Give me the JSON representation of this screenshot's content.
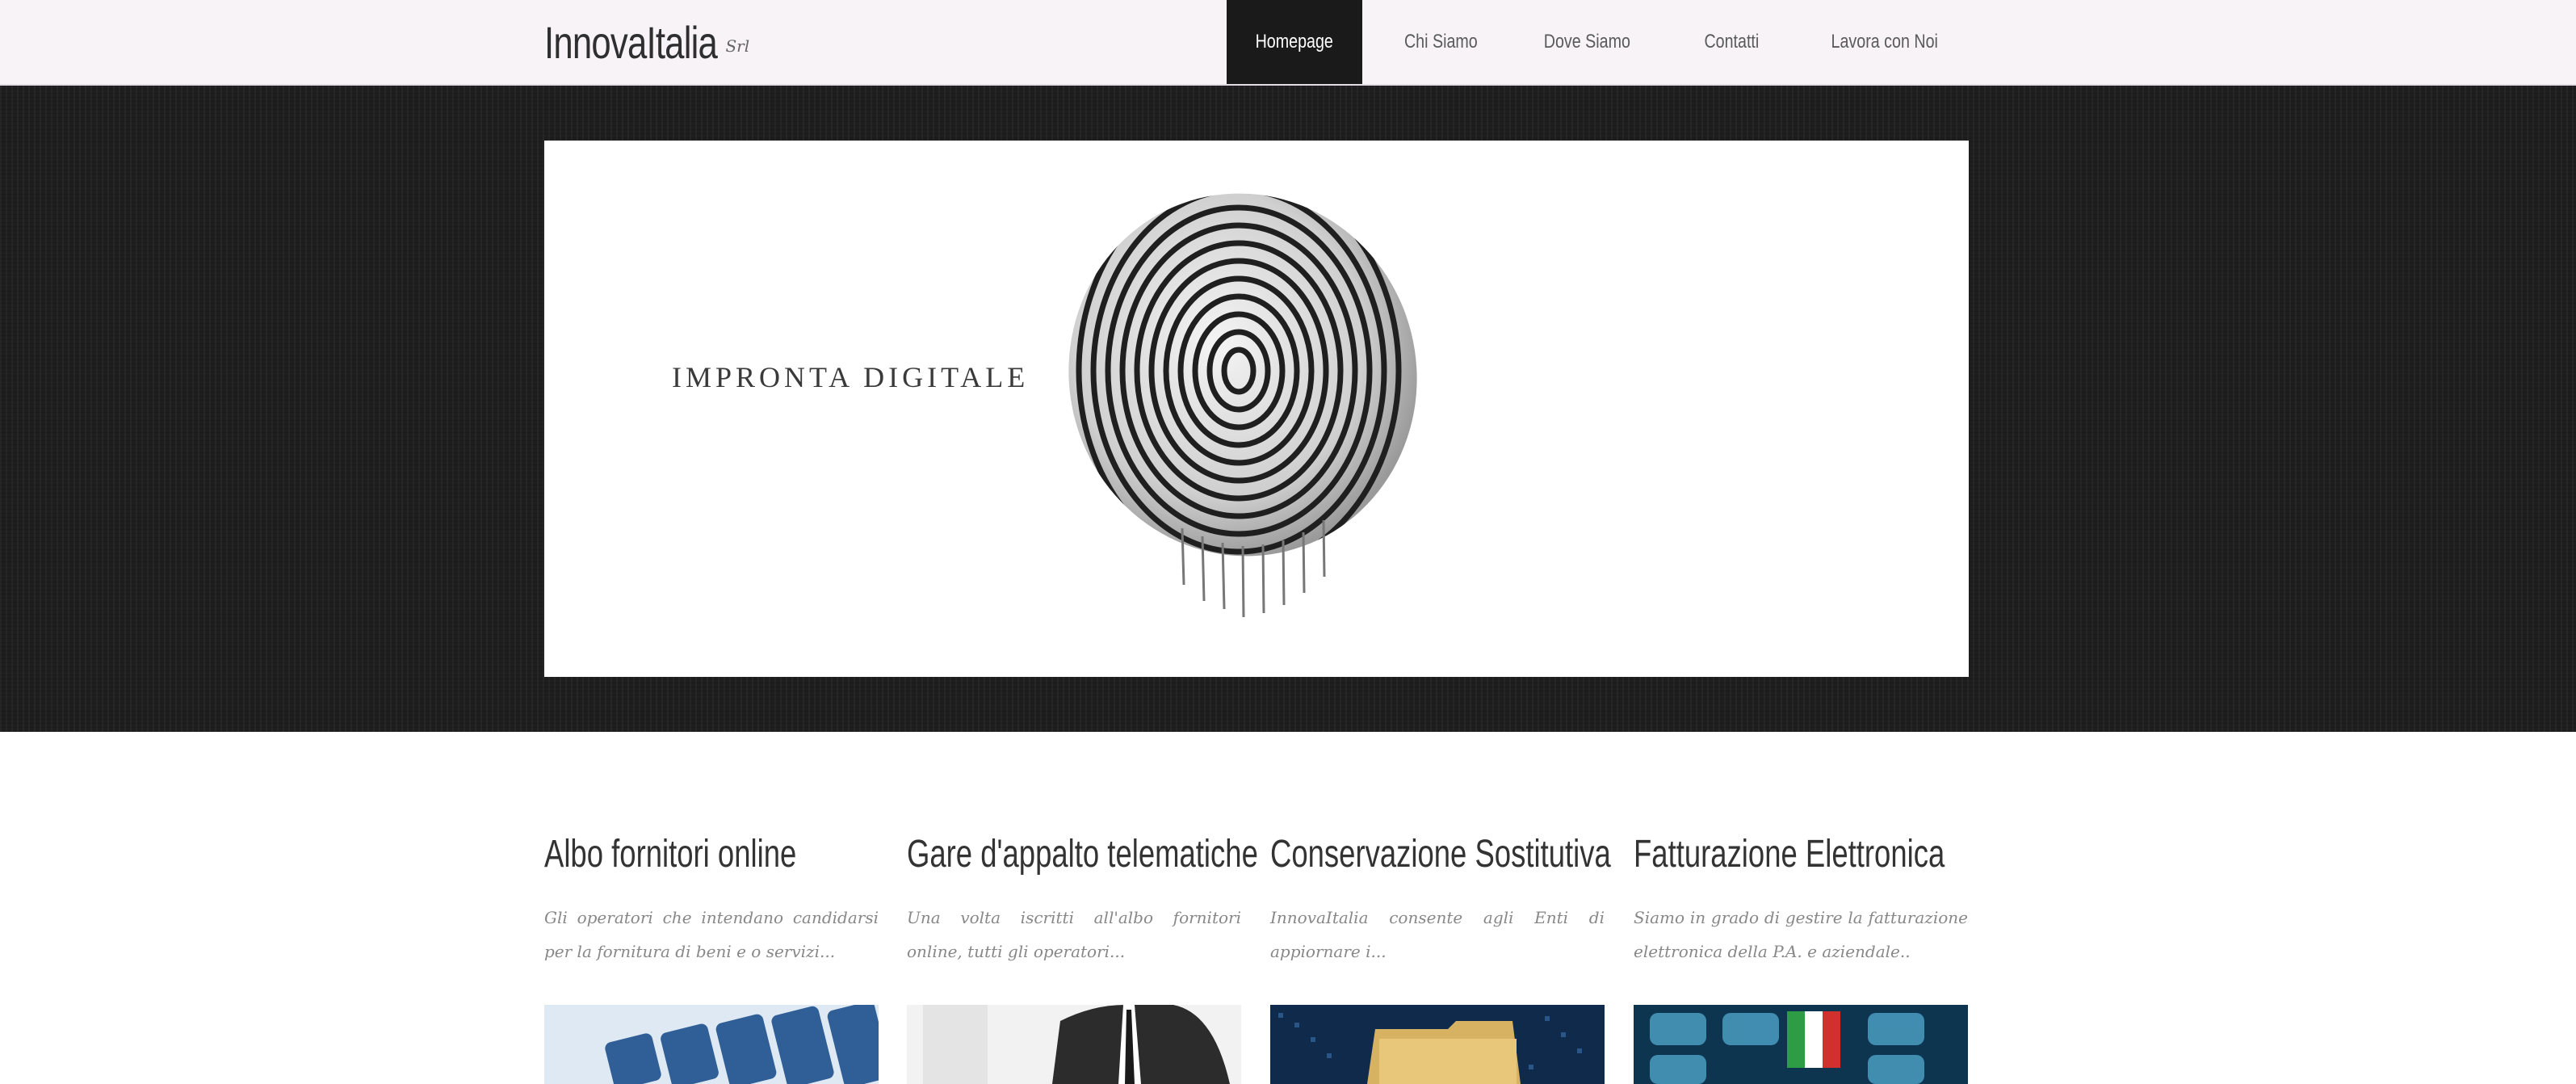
{
  "header": {
    "logo": "InnovaItalia",
    "logo_suffix": "Srl",
    "nav": [
      {
        "label": "Homepage",
        "active": true
      },
      {
        "label": "Chi Siamo",
        "active": false
      },
      {
        "label": "Dove Siamo",
        "active": false
      },
      {
        "label": "Contatti",
        "active": false
      },
      {
        "label": "Lavora con Noi",
        "active": false
      }
    ]
  },
  "hero": {
    "banner_title": "IMPRONTA DIGITALE"
  },
  "features": [
    {
      "title": "Albo fornitori online",
      "text": "Gli operatori che intendano candidarsi per la fornitura di beni e o servizi..."
    },
    {
      "title": "Gare d'appalto telematiche",
      "text": "Una volta iscritti all'albo fornitori online, tutti gli operatori..."
    },
    {
      "title": "Conservazione Sostitutiva",
      "text": "InnovaItalia consente agli Enti di appiornare i..."
    },
    {
      "title": "Fatturazione Elettronica",
      "text": "Siamo in grado di gestire la fatturazione elettronica della P.A. e aziendale.."
    }
  ]
}
